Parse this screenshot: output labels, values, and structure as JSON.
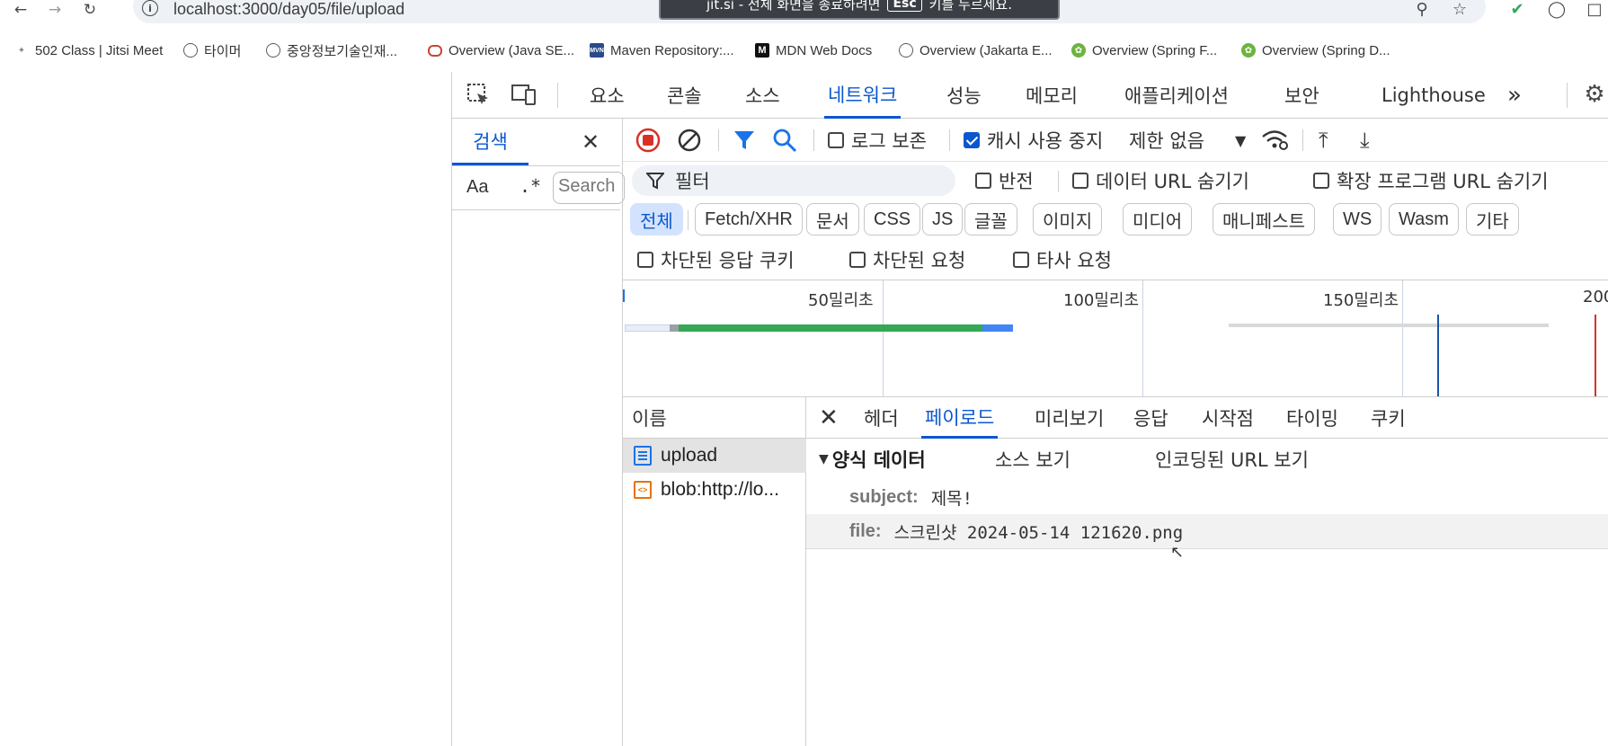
{
  "browser": {
    "url": "localhost:3000/day05/file/upload",
    "share_banner": {
      "text_prefix": "jit.si - 전체 화면을 종료하려면",
      "key": "Esc",
      "text_suffix": "키를 누르세요."
    },
    "bookmarks": [
      {
        "label": "502 Class | Jitsi Meet",
        "icon": "jitsi-icon"
      },
      {
        "label": "타이머",
        "icon": "globe-icon"
      },
      {
        "label": "중앙정보기술인재...",
        "icon": "globe-icon"
      },
      {
        "label": "Overview (Java SE...",
        "icon": "oracle-icon"
      },
      {
        "label": "Maven Repository:...",
        "icon": "maven-icon"
      },
      {
        "label": "MDN Web Docs",
        "icon": "mdn-icon"
      },
      {
        "label": "Overview (Jakarta E...",
        "icon": "globe-icon"
      },
      {
        "label": "Overview (Spring F...",
        "icon": "spring-icon"
      },
      {
        "label": "Overview (Spring D...",
        "icon": "spring-icon"
      }
    ]
  },
  "devtools": {
    "tabs": [
      "요소",
      "콘솔",
      "소스",
      "네트워크",
      "성능",
      "메모리",
      "애플리케이션",
      "보안",
      "Lighthouse"
    ],
    "active_tab": "네트워크",
    "search_panel": {
      "tab_label": "검색",
      "case_label": "Aa",
      "regex_label": ".*",
      "placeholder": "Search"
    },
    "network": {
      "preserve_log": "로그 보존",
      "disable_cache": "캐시 사용 중지",
      "throttle": "제한 없음",
      "filter_placeholder": "필터",
      "invert": "반전",
      "hide_data_urls": "데이터 URL 숨기기",
      "hide_ext_urls": "확장 프로그램 URL 숨기기",
      "type_chips": [
        "전체",
        "Fetch/XHR",
        "문서",
        "CSS",
        "JS",
        "글꼴",
        "이미지",
        "미디어",
        "매니페스트",
        "WS",
        "Wasm",
        "기타"
      ],
      "blocked_cookies": "차단된 응답 쿠키",
      "blocked_requests": "차단된 요청",
      "third_party": "타사 요청",
      "timeline_labels": [
        "50밀리초",
        "100밀리초",
        "150밀리초",
        "200"
      ],
      "name_header": "이름",
      "requests": [
        "upload",
        "blob:http://lo..."
      ],
      "detail_tabs": [
        "헤더",
        "페이로드",
        "미리보기",
        "응답",
        "시작점",
        "타이밍",
        "쿠키"
      ],
      "active_detail_tab": "페이로드",
      "payload": {
        "section_title": "양식 데이터",
        "view_source": "소스 보기",
        "view_url_encoded": "인코딩된 URL 보기",
        "fields": [
          {
            "key": "subject:",
            "value": "제목!"
          },
          {
            "key": "file:",
            "value": "스크린샷 2024-05-14 121620.png"
          }
        ]
      }
    }
  }
}
